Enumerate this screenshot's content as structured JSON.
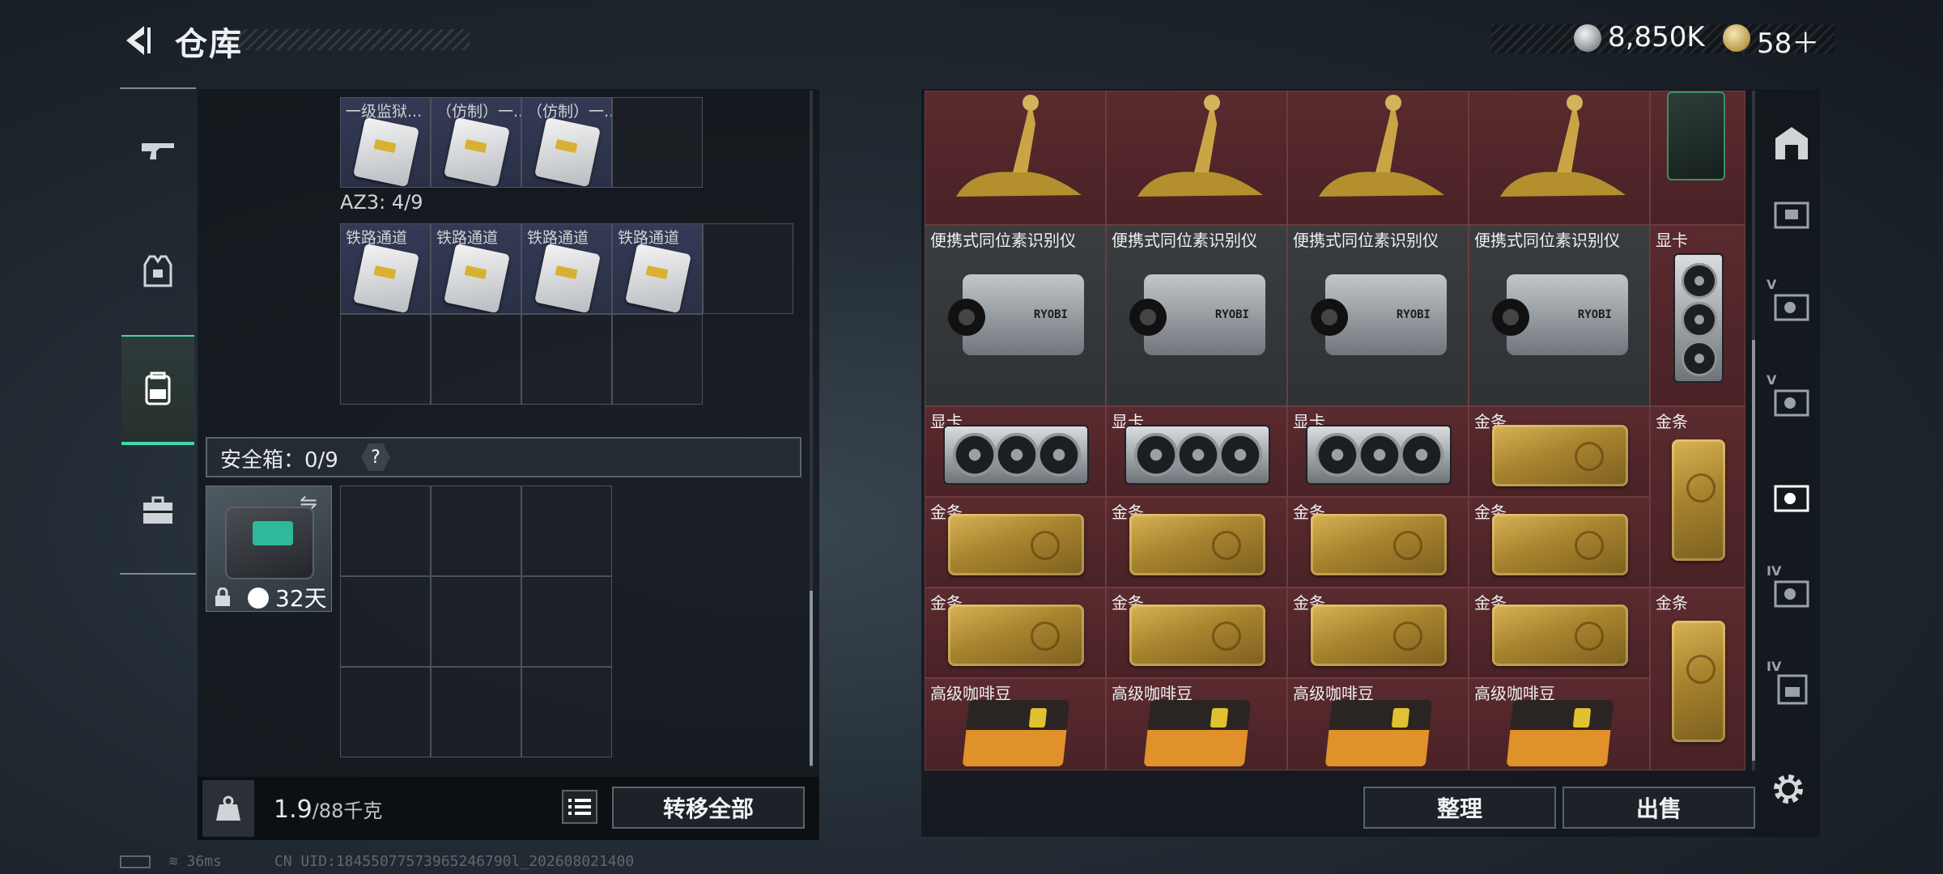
{
  "header": {
    "title": "仓库",
    "currency_silver": "8,850K",
    "currency_gold": "58＋"
  },
  "nav": {
    "items": [
      {
        "id": "weapons",
        "icon": "gun-icon"
      },
      {
        "id": "equipment",
        "icon": "vest-icon"
      },
      {
        "id": "backpack",
        "icon": "backpack-icon",
        "active": true
      },
      {
        "id": "case",
        "icon": "briefcase-icon"
      }
    ]
  },
  "left": {
    "top_grid_labels": [
      "一级监狱...",
      "（仿制）一...",
      "（仿制）一...",
      ""
    ],
    "az3_label": "AZ3: 4/9",
    "az3_labels": [
      "铁路通道",
      "铁路通道",
      "铁路通道",
      "铁路通道"
    ],
    "safe_label": "安全箱：0/9",
    "safe_help": "?",
    "safe_days": "32天",
    "weight_current": "1.9",
    "weight_max": "/88千克",
    "transfer_all": "转移全部"
  },
  "right": {
    "rows": [
      {
        "labels": [
          "",
          "",
          "",
          "",
          ""
        ]
      },
      {
        "labels": [
          "便携式同位素识别仪",
          "便携式同位素识别仪",
          "便携式同位素识别仪",
          "便携式同位素识别仪",
          "显卡"
        ]
      },
      {
        "labels": [
          "显卡",
          "显卡",
          "显卡",
          "金条",
          "金条"
        ]
      },
      {
        "labels": [
          "金条",
          "金条",
          "金条",
          "金条"
        ]
      },
      {
        "labels": [
          "金条",
          "金条",
          "金条",
          "金条",
          "金条"
        ]
      },
      {
        "labels": [
          "高级咖啡豆",
          "高级咖啡豆",
          "高级咖啡豆",
          "高级咖啡豆"
        ]
      }
    ],
    "camera_brand": "RYOBI",
    "sort": "整理",
    "sell": "出售"
  },
  "bag_nav": {
    "tiers": [
      "",
      "",
      "V",
      "V",
      "",
      "IV",
      "IV"
    ]
  },
  "status": {
    "ping": "36ms",
    "uid": "CN UID:18455077573965246790l_202608021400"
  }
}
